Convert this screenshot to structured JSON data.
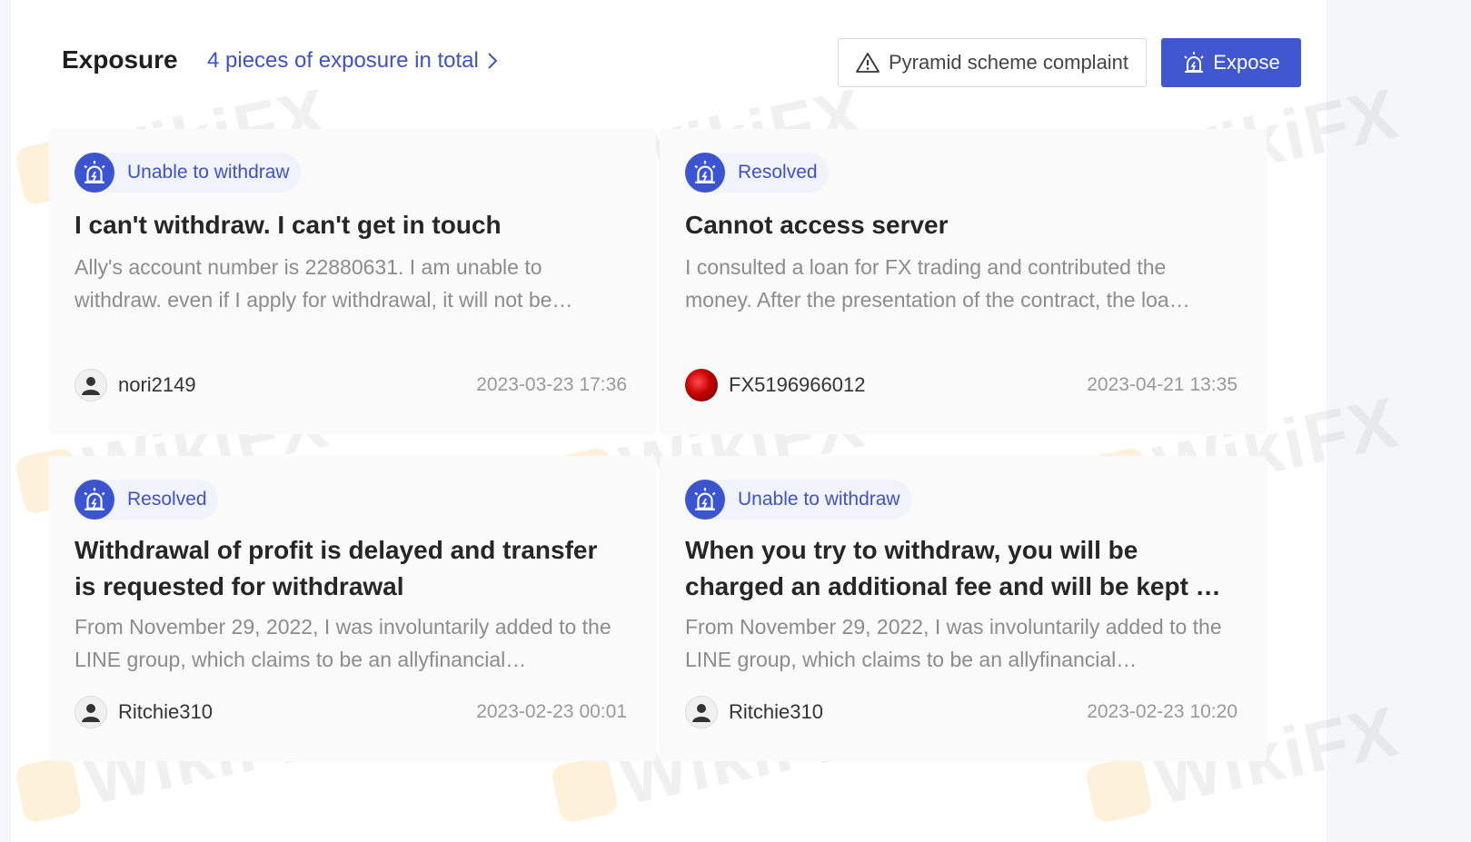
{
  "header": {
    "title": "Exposure",
    "count_link": "4 pieces of exposure in total",
    "complaint_button": "Pyramid scheme complaint",
    "expose_button": "Expose"
  },
  "watermark": "WikiFX",
  "cards": [
    {
      "tag": "Unable to withdraw",
      "title": "I can't withdraw. I can't get in touch",
      "description": "Ally's account number is 22880631. I am unable to withdraw. even if I apply for withdrawal, it will not be…",
      "user": "nori2149",
      "date": "2023-03-23 17:36"
    },
    {
      "tag": "Resolved",
      "title": "Cannot access server",
      "description": "I consulted a loan for FX trading and contributed the money. After the presentation of the contract, the loa…",
      "user": "FX5196966012",
      "date": "2023-04-21 13:35"
    },
    {
      "tag": "Resolved",
      "title": "Withdrawal of profit is delayed and transfer is requested for withdrawal",
      "description": "From November 29, 2022, I was involuntarily added to the LINE group, which claims to be an allyfinancial…",
      "user": "Ritchie310",
      "date": "2023-02-23 00:01"
    },
    {
      "tag": "Unable to withdraw",
      "title": "When you try to withdraw, you will be charged an additional fee and will be kept …",
      "description": "From November 29, 2022, I was involuntarily added to the LINE group, which claims to be an allyfinancial…",
      "user": "Ritchie310",
      "date": "2023-02-23 10:20"
    }
  ]
}
